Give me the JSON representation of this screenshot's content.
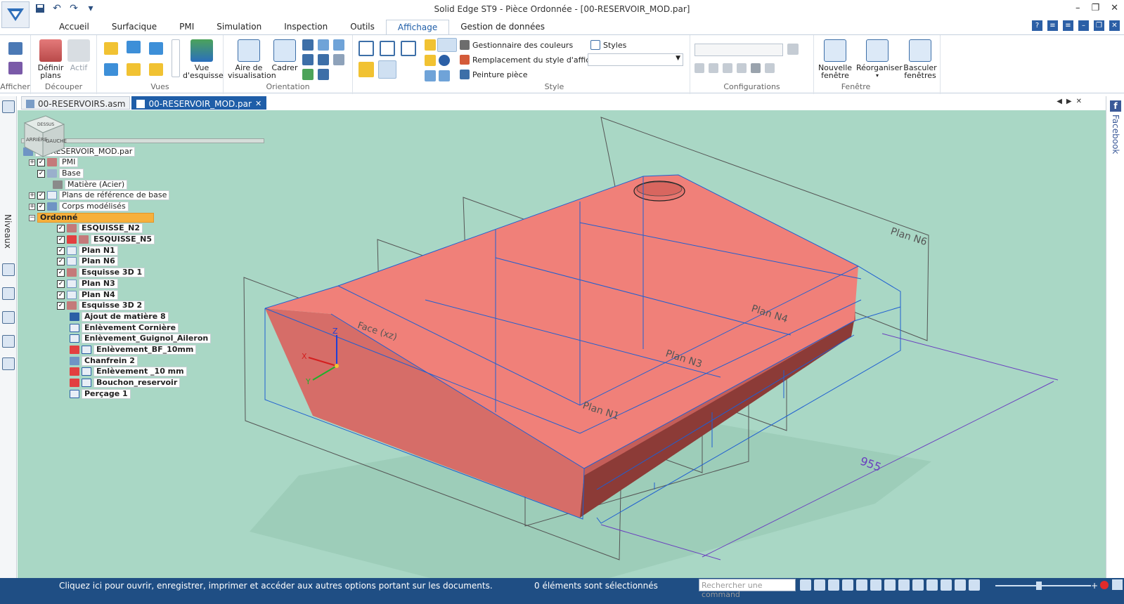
{
  "window": {
    "title": "Solid Edge ST9 - Pièce Ordonnée - [00-RESERVOIR_MOD.par]"
  },
  "ribbon_tabs": [
    "Accueil",
    "Surfacique",
    "PMI",
    "Simulation",
    "Inspection",
    "Outils",
    "Affichage",
    "Gestion de données"
  ],
  "active_tab": "Affichage",
  "ribbon": {
    "afficher": {
      "label": "Afficher"
    },
    "decouper": {
      "label": "Découper",
      "definir_plans_l1": "Définir",
      "definir_plans_l2": "plans",
      "actif": "Actif"
    },
    "vues": {
      "label": "Vues",
      "vue_esquisse_l1": "Vue",
      "vue_esquisse_l2": "d'esquisse"
    },
    "orientation": {
      "label": "Orientation",
      "aire_l1": "Aire de",
      "aire_l2": "visualisation",
      "cadrer": "Cadrer"
    },
    "style": {
      "label": "Style",
      "gestionnaire_couleurs": "Gestionnaire des couleurs",
      "remplacement_style": "Remplacement du style d'affichage",
      "peinture_piece": "Peinture pièce",
      "styles": "Styles"
    },
    "configurations": {
      "label": "Configurations"
    },
    "fenetre": {
      "label": "Fenêtre",
      "nouvelle_l1": "Nouvelle",
      "nouvelle_l2": "fenêtre",
      "reorganiser": "Réorganiser",
      "basculer_l1": "Basculer",
      "basculer_l2": "fenêtres"
    }
  },
  "doc_tabs": [
    {
      "label": "00-RESERVOIRS.asm",
      "active": false
    },
    {
      "label": "00-RESERVOIR_MOD.par",
      "active": true
    }
  ],
  "left_rail": {
    "label": "Niveaux"
  },
  "right_rail": {
    "label": "Facebook"
  },
  "tree": {
    "root": "00-RESERVOIR_MOD.par",
    "items": [
      {
        "label": "PMI",
        "bold": false
      },
      {
        "label": "Base",
        "bold": false
      },
      {
        "label": "Matière (Acier)",
        "bold": false
      },
      {
        "label": "Plans de référence de base",
        "bold": false
      },
      {
        "label": "Corps modélisés",
        "bold": false
      },
      {
        "label": "Ordonné",
        "bold": true
      },
      {
        "label": "ESQUISSE_N2",
        "bold": true
      },
      {
        "label": "ESQUISSE_N5",
        "bold": true
      },
      {
        "label": "Plan N1",
        "bold": true
      },
      {
        "label": "Plan N6",
        "bold": true
      },
      {
        "label": "Esquisse 3D 1",
        "bold": true
      },
      {
        "label": "Plan N3",
        "bold": true
      },
      {
        "label": "Plan N4",
        "bold": true
      },
      {
        "label": "Esquisse 3D 2",
        "bold": true
      },
      {
        "label": "Ajout de matière 8",
        "bold": true
      },
      {
        "label": "Enlèvement Cornière",
        "bold": true
      },
      {
        "label": "Enlèvement_Guignol_Aileron",
        "bold": true
      },
      {
        "label": "Enlèvement_BF_10mm",
        "bold": true
      },
      {
        "label": "Chanfrein 2",
        "bold": true
      },
      {
        "label": "Enlèvement _10 mm",
        "bold": true
      },
      {
        "label": "Bouchon_reservoir",
        "bold": true
      },
      {
        "label": "Perçage 1",
        "bold": true
      }
    ]
  },
  "viewport": {
    "plane_labels": [
      "Plan N6",
      "Plan N4",
      "Plan N3",
      "Plan N1"
    ],
    "face_label": "Face (xz)",
    "axis_x": "X",
    "axis_y": "Y",
    "axis_z": "Z",
    "dimension": "955",
    "viewcube_labels": [
      "ARRIÈRE",
      "GAUCHE",
      "DESSUS"
    ],
    "colors": {
      "background": "#a9d7c5",
      "body": "#f08079",
      "edges": "#1f5fd1"
    }
  },
  "status": {
    "message": "Cliquez ici pour ouvrir, enregistrer, imprimer et accéder aux autres options portant sur les documents.",
    "selection": "0 éléments sont sélectionnés",
    "search_placeholder": "Rechercher une command"
  }
}
